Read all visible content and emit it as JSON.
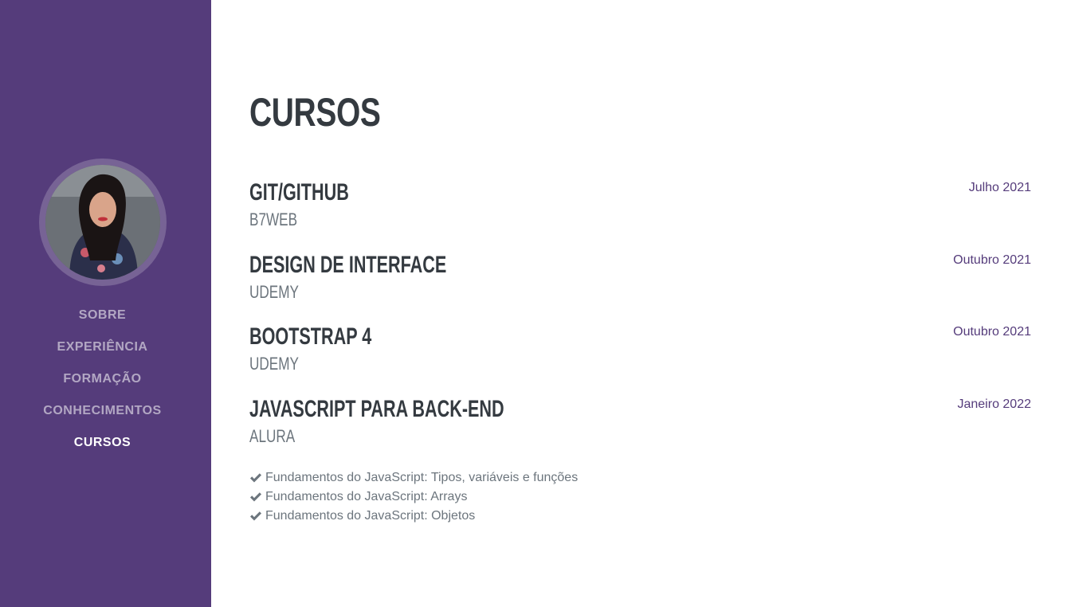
{
  "sidebar": {
    "nav": [
      {
        "label": "SOBRE",
        "active": false
      },
      {
        "label": "EXPERIÊNCIA",
        "active": false
      },
      {
        "label": "FORMAÇÃO",
        "active": false
      },
      {
        "label": "CONHECIMENTOS",
        "active": false
      },
      {
        "label": "CURSOS",
        "active": true
      }
    ]
  },
  "main": {
    "title": "CURSOS",
    "courses": [
      {
        "name": "GIT/GITHUB",
        "school": "B7WEB",
        "date": "Julho 2021"
      },
      {
        "name": "DESIGN DE INTERFACE",
        "school": "UDEMY",
        "date": "Outubro 2021"
      },
      {
        "name": "BOOTSTRAP 4",
        "school": "UDEMY",
        "date": "Outubro 2021"
      },
      {
        "name": "JAVASCRIPT PARA BACK-END",
        "school": "ALURA",
        "date": "Janeiro 2022"
      }
    ],
    "topics": [
      "Fundamentos do JavaScript: Tipos, variáveis e funções",
      "Fundamentos do JavaScript: Arrays",
      "Fundamentos do JavaScript: Objetos"
    ]
  },
  "colors": {
    "sidebar_bg": "#553c7b",
    "heading": "#343a40",
    "muted": "#6c757d",
    "accent": "#553c7b"
  },
  "icons": {
    "check": "check-icon",
    "avatar": "profile-photo"
  }
}
